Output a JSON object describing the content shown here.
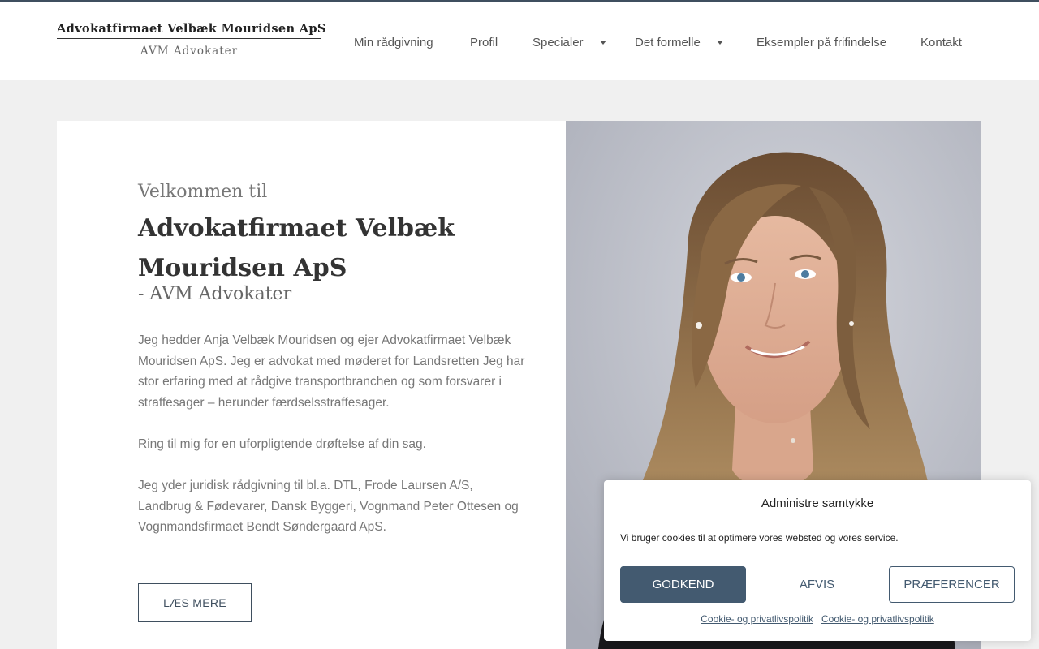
{
  "header": {
    "logo_title": "Advokatfirmaet Velbæk Mouridsen ApS",
    "logo_subtitle": "AVM Advokater"
  },
  "nav": {
    "items": [
      {
        "label": "Min rådgivning",
        "has_dropdown": false
      },
      {
        "label": "Profil",
        "has_dropdown": false
      },
      {
        "label": "Specialer",
        "has_dropdown": true
      },
      {
        "label": "Det formelle",
        "has_dropdown": true
      },
      {
        "label": "Eksempler på frifindelse",
        "has_dropdown": false
      },
      {
        "label": "Kontakt",
        "has_dropdown": false
      }
    ]
  },
  "hero": {
    "welcome": "Velkommen til",
    "firm_name": "Advokatfirmaet Velbæk Mouridsen ApS",
    "subtitle": "- AVM Advokater",
    "paragraph1": "Jeg hedder Anja Velbæk Mouridsen og ejer Advokatfirmaet Velbæk Mouridsen ApS. Jeg er advokat med møderet for Landsretten Jeg har stor erfaring med at rådgive transportbranchen og som forsvarer i straffesager – herunder færdselsstraffesager.",
    "paragraph2": "Ring til mig for en uforpligtende drøftelse af din sag.",
    "paragraph3": "Jeg yder juridisk rådgivning til bl.a. DTL, Frode Laursen A/S, Landbrug & Fødevarer, Dansk Byggeri, Vognmand Peter Ottesen og Vognmandsfirmaet Bendt Søndergaard ApS.",
    "read_more": "LÆS MERE"
  },
  "cookie": {
    "title": "Administre samtykke",
    "text": "Vi bruger cookies til at optimere vores websted og vores service.",
    "accept": "GODKEND",
    "deny": "AFVIS",
    "preferences": "PRÆFERENCER",
    "link1": "Cookie- og privatlivspolitik",
    "link2": "Cookie- og privatlivspolitik"
  },
  "colors": {
    "accent": "#435a70",
    "topbar": "#3f4f5f",
    "page_bg": "#f0f0f0"
  },
  "icons": {
    "dropdown": "caret-down-icon"
  }
}
